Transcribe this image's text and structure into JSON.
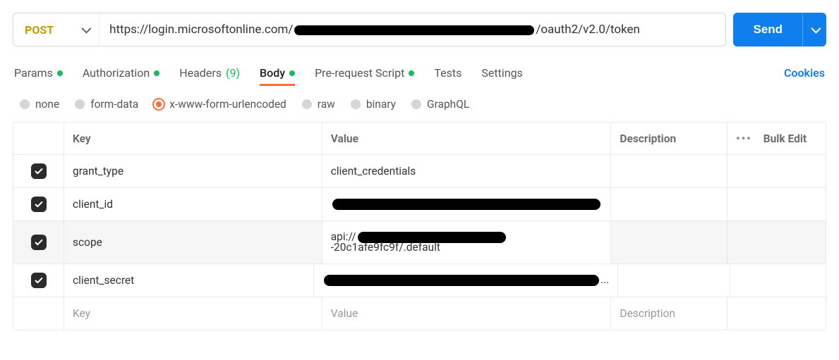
{
  "request": {
    "method": "POST",
    "url_prefix": "https://login.microsoftonline.com/",
    "url_suffix": "/oauth2/v2.0/token"
  },
  "send": {
    "label": "Send"
  },
  "tabs": {
    "params": "Params",
    "authorization": "Authorization",
    "headers": "Headers",
    "headers_count": "(9)",
    "body": "Body",
    "pre_request": "Pre-request Script",
    "tests": "Tests",
    "settings": "Settings",
    "cookies": "Cookies"
  },
  "body_types": {
    "none": "none",
    "form_data": "form-data",
    "urlencoded": "x-www-form-urlencoded",
    "raw": "raw",
    "binary": "binary",
    "graphql": "GraphQL"
  },
  "table": {
    "headers": {
      "key": "Key",
      "value": "Value",
      "description": "Description",
      "bulk_edit": "Bulk Edit"
    },
    "rows": [
      {
        "key": "grant_type",
        "value": "client_credentials"
      },
      {
        "key": "client_id",
        "value": ""
      },
      {
        "key": "scope",
        "value_prefix": "api://",
        "value_suffix": "-20c1afe9fc9f/.default"
      },
      {
        "key": "client_secret",
        "value": ""
      }
    ],
    "placeholders": {
      "key": "Key",
      "value": "Value",
      "description": "Description"
    }
  }
}
